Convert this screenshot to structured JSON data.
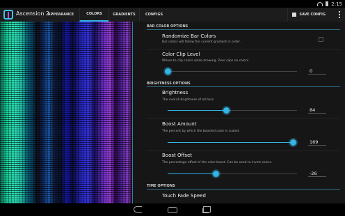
{
  "status": {
    "time": "2:15"
  },
  "app": {
    "title": "Ascension 2"
  },
  "tabs": [
    {
      "label": "APPEARANCE"
    },
    {
      "label": "COLORS"
    },
    {
      "label": "GRADIENTS"
    },
    {
      "label": "CONFIGS"
    }
  ],
  "actions": {
    "save_label": "SAVE CONFIG"
  },
  "sections": {
    "bar_color": "BAR COLOR OPTIONS",
    "brightness": "BRIGHTNESS OPTIONS",
    "time": "TIME OPTIONS"
  },
  "settings": {
    "randomize": {
      "title": "Randomize Bar Colors",
      "desc": "Bar colors will follow the current gradient in order.",
      "checked": false
    },
    "color_clip": {
      "title": "Color Clip Level",
      "desc": "Where to clip colors while drawing. Zero clips no colors.",
      "value": "0",
      "fraction": 0.0
    },
    "brightness": {
      "title": "Brightness",
      "desc": "The overall brightness of all bars.",
      "value": "84",
      "fraction": 0.45
    },
    "boost_amount": {
      "title": "Boost Amount",
      "desc": "The percent by which the boosted color is scaled.",
      "value": "169",
      "fraction": 0.97
    },
    "boost_offset": {
      "title": "Boost Offset",
      "desc": "The percentage offset of the color boost. Can be used to invert colors.",
      "value": "-26",
      "fraction": 0.37
    },
    "touch_fade": {
      "title": "Touch Fade Speed"
    }
  },
  "colors": {
    "accent": "#33b5e5"
  }
}
